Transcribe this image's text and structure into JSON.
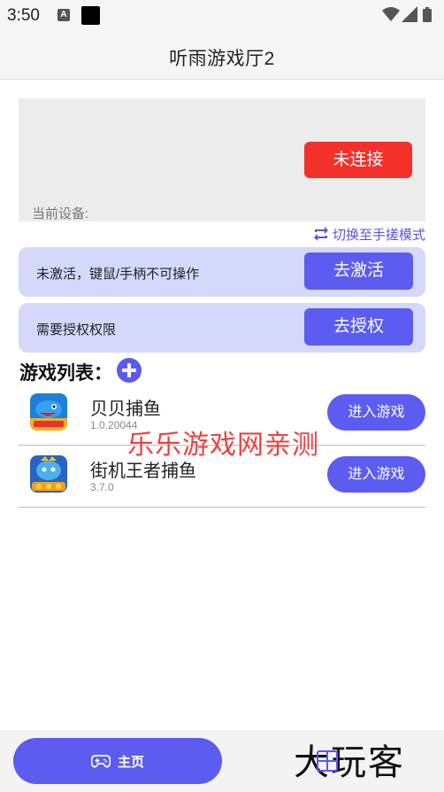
{
  "status_bar": {
    "time": "3:50",
    "notification_icon": "a-notification-icon",
    "icons": [
      "wifi-icon",
      "signal-icon",
      "battery-icon"
    ]
  },
  "header": {
    "title": "听雨游戏厅2"
  },
  "connection": {
    "connect_label": "未连接",
    "device_label": "当前设备:",
    "switch_mode_label": "切换至手搓模式"
  },
  "cards": {
    "activate_text": "未激活，键鼠/手柄不可操作",
    "activate_button": "去激活",
    "auth_text": "需要授权权限",
    "auth_button": "去授权"
  },
  "game_list": {
    "title": "游戏列表：",
    "enter_label": "进入游戏",
    "games": [
      {
        "name": "贝贝捕鱼",
        "version": "1.0.20044"
      },
      {
        "name": "街机王者捕鱼",
        "version": "3.7.0"
      }
    ]
  },
  "watermark": "乐乐游戏网亲测",
  "bottom_nav": {
    "home_label": "主页",
    "brand": "大玩客"
  },
  "colors": {
    "accent": "#5c5cf0",
    "danger": "#f4302b",
    "card_bg": "#d4d9fb"
  }
}
